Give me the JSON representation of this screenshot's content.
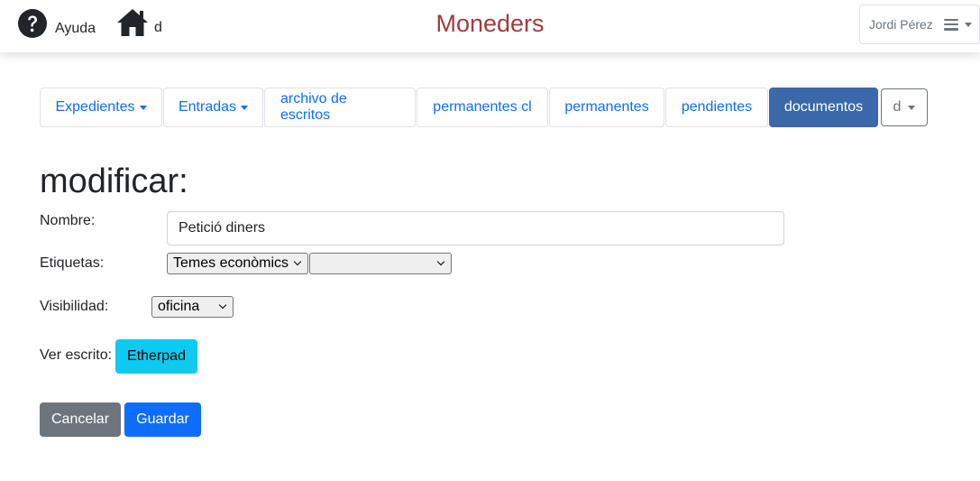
{
  "topbar": {
    "help_label": "Ayuda",
    "home_label": "d",
    "title": "Moneders",
    "user_name": "Jordi Pérez"
  },
  "tabs": [
    {
      "label": "Expedientes",
      "dropdown": true
    },
    {
      "label": "Entradas",
      "dropdown": true
    },
    {
      "label": "archivo de escritos",
      "dropdown": false
    },
    {
      "label": "permanentes cl",
      "dropdown": false
    },
    {
      "label": "permanentes",
      "dropdown": false
    },
    {
      "label": "pendientes",
      "dropdown": false
    },
    {
      "label": "documentos",
      "dropdown": false,
      "active": true
    },
    {
      "label": "d",
      "dropdown": true
    }
  ],
  "form": {
    "title": "modificar:",
    "nombre_label": "Nombre:",
    "nombre_value": "Petició diners",
    "etiquetas_label": "Etiquetas:",
    "etiqueta1_selected": "Temes econòmics",
    "etiqueta2_selected": "",
    "visibilidad_label": "Visibilidad:",
    "visibilidad_selected": "oficina",
    "ver_escrito_label": "Ver escrito:",
    "etherpad_button": "Etherpad",
    "cancel_button": "Cancelar",
    "save_button": "Guardar"
  },
  "colors": {
    "title": "#a33b3b",
    "link": "#0d6efd",
    "active_tab": "#3a68a9",
    "info_button": "#0dcaf0",
    "secondary_button": "#6c757d",
    "primary_button": "#0d6efd"
  }
}
